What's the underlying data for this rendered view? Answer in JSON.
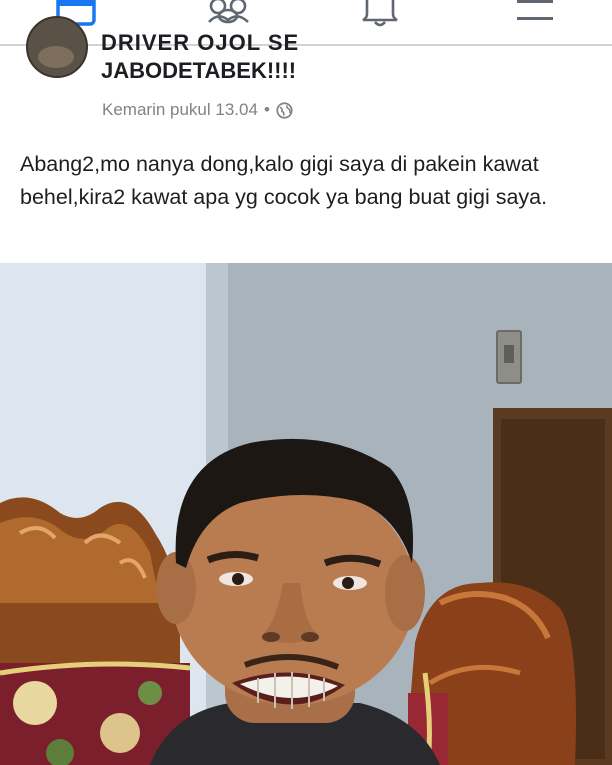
{
  "nav": {
    "icons": [
      "home-icon",
      "friends-icon",
      "notifications-icon",
      "menu-icon"
    ]
  },
  "post": {
    "group_name_cut": "DRIVER OJOL SE",
    "group_name": "JABODETABEK!!!!",
    "timestamp": "Kemarin pukul 13.04",
    "separator": "•",
    "privacy_icon": "globe-icon",
    "text": "Abang2,mo nanya dong,kalo gigi saya di pakein kawat behel,kira2 kawat apa yg cocok ya bang buat gigi saya."
  },
  "colors": {
    "nav_active": "#1877f2",
    "nav_inactive": "#606770",
    "meta_text": "#7f8389"
  }
}
